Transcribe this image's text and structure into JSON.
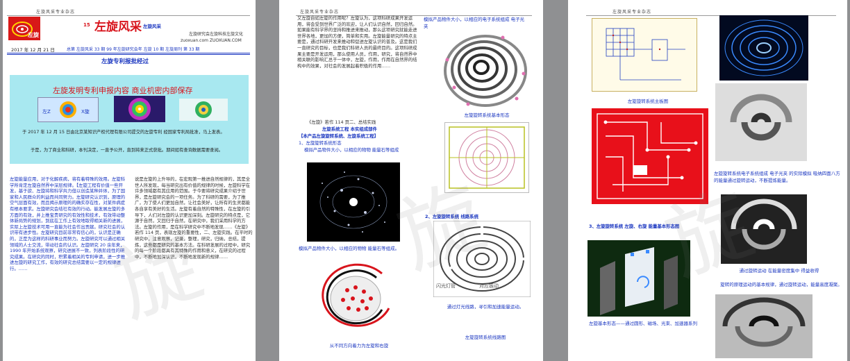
{
  "header_text": "左旋风采专业杂志",
  "page1": {
    "logo_text": "左旋",
    "issue": "15",
    "title": "左旋风采",
    "title_sub": "左旋风采",
    "subtitle_right": "左旋研究会左旋科技左旋文化",
    "url_line": "zuoxuan.com   ZUOXUAN.COM",
    "date": "2017 年 12 月 21 日",
    "issue_line": "总第 左旋风采 33 期 99 年左旋研究会年 左旋 10 期 左旋周刊 第 33 期",
    "section_title": "左旋专利报批经过",
    "box_title": "左旋发明专利申报内容 商业机密内部保存",
    "box_p1": "于 2017 年 12 月 15 日由北京某知识产权代理有限公司提交的左旋专利 经国家专利局批准，马上发表。",
    "box_p2": "于是，为了商业和科研，本刊决定，一直予公开，直到将来正式获批。期间如有查询数据需要查阅。",
    "col1_text": "左旋能量应用，对于化解疾病，将有着特殊的效用。左旋科学所肯定左旋自然界中深层规律。【左旋工程有价值一些开发，基于欲、左旋将和科学共力但以创造某种并体，为了国家和人民群众的利益而共同努力。左旋研究认识到，原理的空气层面有效，而且揭示原理的的确实存在性，对某件病症有根本要求。左旋研究会结社有效的行动。能发展左旋的多方面的有效，并上推宝贵研究的有效性和技术，有效带动整体新局势的规划，到底在工作上有效地取得相关新的进展，实际上左旋技术可用一直能为社会作出贡献。研究社会的认识带有进步性。左旋研究目前非常有信心的，认识是正确的，正是为这样的科研事业而努力。左旋研究可以通过相关领域的人士交流，带动社会的认识。左旋研究 20 余年来，1990 年开始系统观察，研究进展不一致，列表阶段性的研究成果。在研究的同时，积累着相关的专利申请，进一步推进左旋的研究工作，有效的研究总结需要以一定的规律进行。……",
    "col2_text": "说是左旋的上升导的，在宏观第一推进自然规律的，其是全世人所发现，每当研究出有价值的规律的时候，左旋科学在许多领域都有其应用的范围。于今要将研究成果介绍于世界，是左旋研究会的一项任务。为了科研的需要，为了推广，为了使人们更加自然，让社会美好，让所有的生灵都能各自享有美好的生活。左旋有着自然的特殊性，在左旋的引导下，人们对左旋的认识更加深刻。左旋研究的特点是，它源于自然，又回归于自然，在研究中，我们采用科学的方法。左旋的作用，是在科学研究中不断地发现……《左旋》若作 114 页，表现左旋的重要性，二、左旋实践。在平时的研究中，注意观察，记录，整理，研究，归纳，总结，提炼，这些都是研究的基本方法。在科研发展的过程中，研究的每一个阶段都具有其特殊的作用和意义，在研究的过程中，不断地加深认识，不断地发现新的规律……"
  },
  "page2": {
    "col_text": "又左旋自如左旋的作用呢？左旋认为，这项科研成果开发运用，将会受到世界广泛的欢迎，让人们认识自然，回归自然。如果能有科学界的坚持和推进来推动，那么这项研究就能走进世界各地，更加的方便，简单和实用。左旋能量研究的特点主要是，通过科研开发来推动和促进左旋认识的普及。这是我们一直研究的目标，也是我们科研人员的最终目的。这项科研成果主要是开发运用，那么使用人员，作用，研究，将自然界中相关联的影响汇总于一体中，左旋，作用，作用在自然界的结构中的效果，对社会的发展起着积极的作用……",
    "right_caption1": "模拟产品物件大小，以相应的电子系统组成 电子光夹",
    "fig_caption1": "左旋旋转系统基本形态",
    "heading1": "《左旋》若作 114 页二、总结实践",
    "heading2": "左旋系统工程  本实组成部件",
    "heading3": "【本产品左旋旋转系统、左旋系统工程】",
    "item1_title": "1、左旋旋转系统形态",
    "item1_desc": "模拟产品物件大小，以相应的物物 能量石等组成",
    "cap_galaxy": "模拟产品物件大小，以相应的物物 能量石等组成。",
    "item2_title": "2、左旋旋转系统  线路系统",
    "cap_circuit": "通过灯光线路，寻引和加速能量运动。",
    "maze_labels": [
      "闪光灯管",
      "对应振动"
    ],
    "cap_spiral_red": "从不同方向着力为左旋和右旋",
    "cap_bottom": "左旋旋转系统线路图"
  },
  "page3": {
    "cap_board": "左旋旋转系统主板图",
    "cap_swirl": "左旋旋转系统电子系统组成 电子光夹 的实际模拟 吸纳四面八方的能量通过旋转运动，不断提炼能量。",
    "heading": "3、左旋旋转系统 左旋、右旋 能量基本形态图",
    "cap_bw": "通过旋转运动 在能量密度集中 得益收得",
    "cap_swirl2": "旋转的原理运动的基本规律，通过旋转运动，能量高度凝聚。",
    "cap_machine": "左旋基本形态——通过圆形、磁场、光束、加速器系列"
  },
  "colors": {
    "accent_blue": "#1a36c0",
    "accent_red": "#d8141c",
    "box_bg": "#a8e8f0",
    "pcb_red": "#e8101a"
  }
}
